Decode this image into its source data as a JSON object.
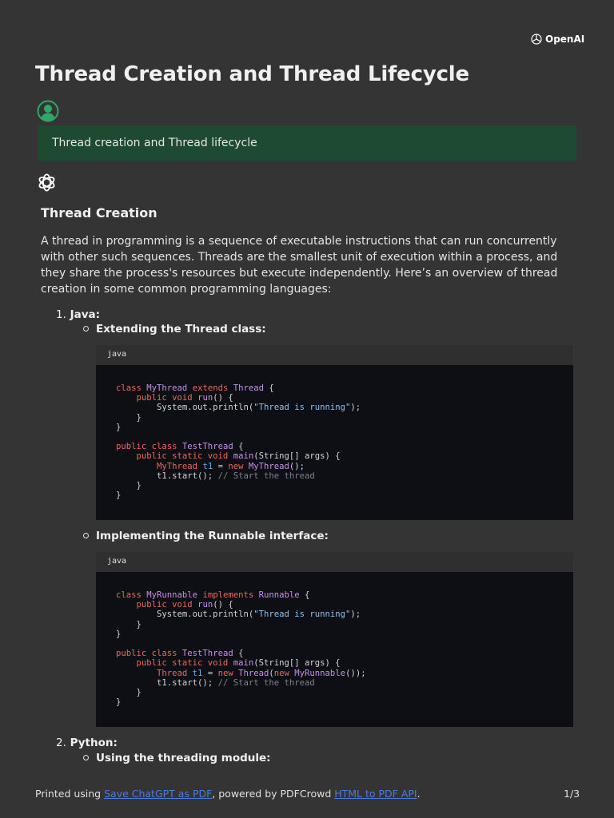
{
  "brand": {
    "name": "OpenAI"
  },
  "title": "Thread Creation and Thread Lifecycle",
  "prompt": "Thread creation and Thread lifecycle",
  "response": {
    "heading": "Thread Creation",
    "paragraph": "A thread in programming is a sequence of executable instructions that can run concurrently with other such sequences. Threads are the smallest unit of execution within a process, and they share the process's resources but execute independently. Here’s an overview of thread creation in some common programming languages:",
    "list": [
      {
        "num": "1.",
        "label": "Java:",
        "subitems": [
          {
            "label": "Extending the Thread class:",
            "lang": "java",
            "code": [
              [
                [
                  "class ",
                  "k"
                ],
                [
                  "MyThread ",
                  "t"
                ],
                [
                  "extends ",
                  "k"
                ],
                [
                  "Thread ",
                  "t"
                ],
                [
                  "{",
                  "p"
                ]
              ],
              [
                [
                  "    public void ",
                  "k"
                ],
                [
                  "run",
                  "t"
                ],
                [
                  "() {",
                  "p"
                ]
              ],
              [
                [
                  "        System.out.println(",
                  "p"
                ],
                [
                  "\"Thread is running\"",
                  "s"
                ],
                [
                  ");",
                  "p"
                ]
              ],
              [
                [
                  "    }",
                  "p"
                ]
              ],
              [
                [
                  "}",
                  "p"
                ]
              ],
              [
                [
                  "",
                  ""
                ]
              ],
              [
                [
                  "public class ",
                  "k"
                ],
                [
                  "TestThread ",
                  "t"
                ],
                [
                  "{",
                  "p"
                ]
              ],
              [
                [
                  "    public static void ",
                  "k"
                ],
                [
                  "main",
                  "t"
                ],
                [
                  "(String[] args) {",
                  "p"
                ]
              ],
              [
                [
                  "        MyThread ",
                  "k"
                ],
                [
                  "t1 ",
                  "v"
                ],
                [
                  "= ",
                  "p"
                ],
                [
                  "new ",
                  "k"
                ],
                [
                  "MyThread",
                  "t"
                ],
                [
                  "();",
                  "p"
                ]
              ],
              [
                [
                  "        t1.start(); ",
                  "p"
                ],
                [
                  "// Start the thread",
                  "c"
                ]
              ],
              [
                [
                  "    }",
                  "p"
                ]
              ],
              [
                [
                  "}",
                  "p"
                ]
              ]
            ]
          },
          {
            "label": "Implementing the Runnable interface:",
            "lang": "java",
            "code": [
              [
                [
                  "class ",
                  "k"
                ],
                [
                  "MyRunnable ",
                  "t"
                ],
                [
                  "implements ",
                  "k"
                ],
                [
                  "Runnable ",
                  "t"
                ],
                [
                  "{",
                  "p"
                ]
              ],
              [
                [
                  "    public void ",
                  "k"
                ],
                [
                  "run",
                  "t"
                ],
                [
                  "() {",
                  "p"
                ]
              ],
              [
                [
                  "        System.out.println(",
                  "p"
                ],
                [
                  "\"Thread is running\"",
                  "s"
                ],
                [
                  ");",
                  "p"
                ]
              ],
              [
                [
                  "    }",
                  "p"
                ]
              ],
              [
                [
                  "}",
                  "p"
                ]
              ],
              [
                [
                  "",
                  ""
                ]
              ],
              [
                [
                  "public class ",
                  "k"
                ],
                [
                  "TestThread ",
                  "t"
                ],
                [
                  "{",
                  "p"
                ]
              ],
              [
                [
                  "    public static void ",
                  "k"
                ],
                [
                  "main",
                  "t"
                ],
                [
                  "(String[] args) {",
                  "p"
                ]
              ],
              [
                [
                  "        Thread ",
                  "k"
                ],
                [
                  "t1 ",
                  "v"
                ],
                [
                  "= ",
                  "p"
                ],
                [
                  "new ",
                  "k"
                ],
                [
                  "Thread",
                  "t"
                ],
                [
                  "(",
                  "p"
                ],
                [
                  "new ",
                  "k"
                ],
                [
                  "MyRunnable",
                  "t"
                ],
                [
                  "());",
                  "p"
                ]
              ],
              [
                [
                  "        t1.start(); ",
                  "p"
                ],
                [
                  "// Start the thread",
                  "c"
                ]
              ],
              [
                [
                  "    }",
                  "p"
                ]
              ],
              [
                [
                  "}",
                  "p"
                ]
              ]
            ]
          }
        ]
      },
      {
        "num": "2.",
        "label": "Python:",
        "subitems": [
          {
            "label": "Using the threading module:"
          }
        ]
      }
    ]
  },
  "footer": {
    "prefix": "Printed using ",
    "link1": "Save ChatGPT as PDF",
    "middle": ", powered by PDFCrowd ",
    "link2": "HTML to PDF API",
    "suffix": ".",
    "page": "1/3"
  },
  "colors": {
    "background": "#343434",
    "prompt_bg": "#1d4a30",
    "accent": "#2ea866",
    "link": "#4b7ae0"
  }
}
